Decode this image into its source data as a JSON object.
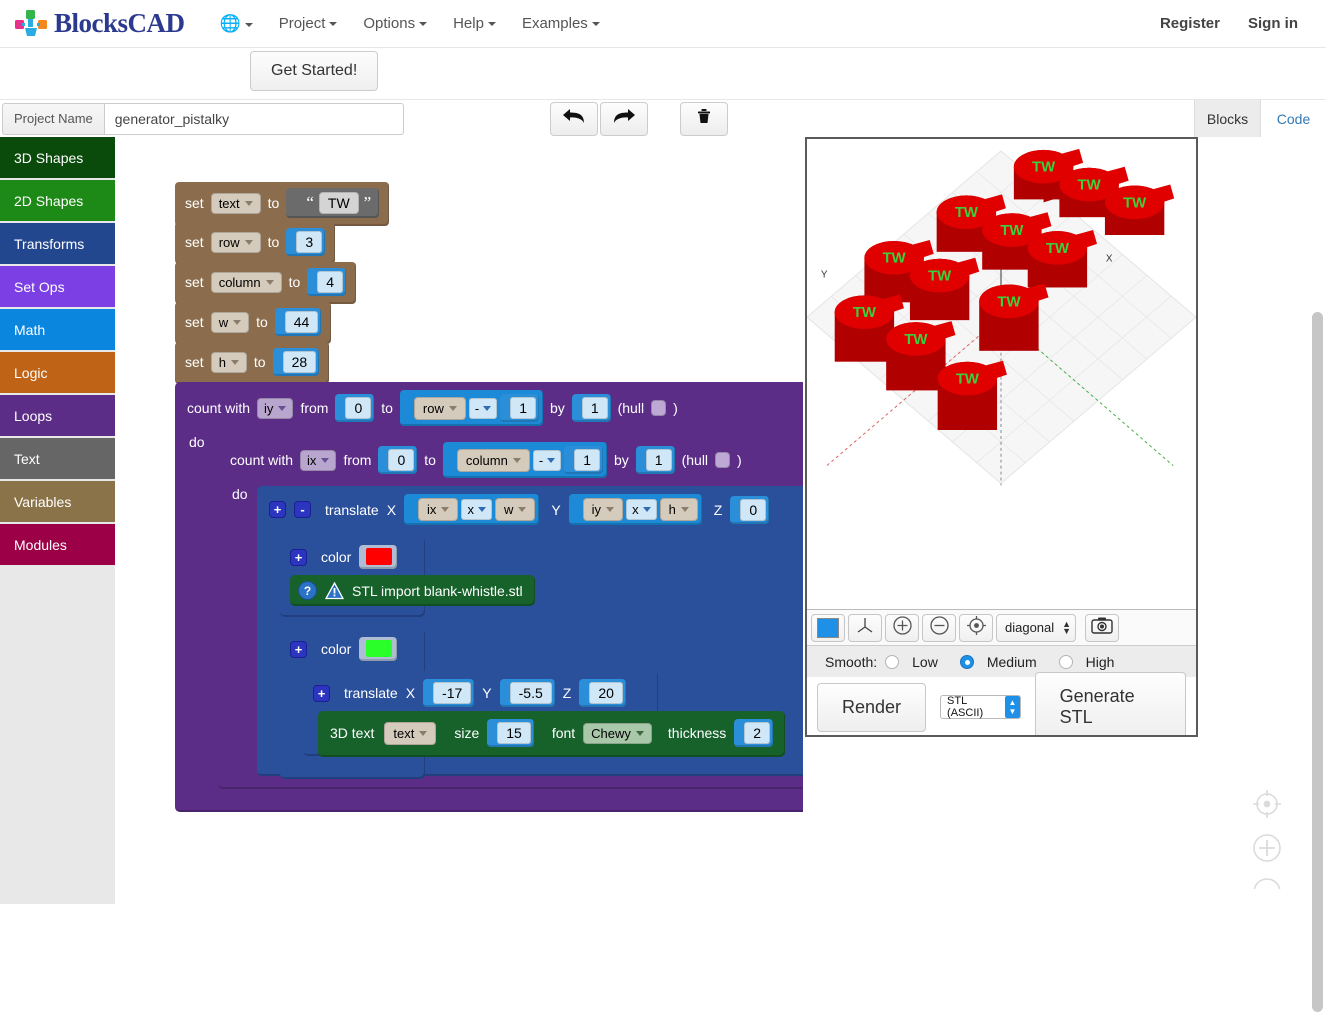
{
  "app": {
    "brand": "BlocksCAD",
    "logo_icon": "blockscad-logo-icon"
  },
  "navbar": {
    "language_icon": "globe-icon",
    "items": [
      {
        "label": "Project",
        "caret": true
      },
      {
        "label": "Options",
        "caret": true
      },
      {
        "label": "Help",
        "caret": true
      },
      {
        "label": "Examples",
        "caret": true
      }
    ],
    "right": [
      {
        "label": "Register"
      },
      {
        "label": "Sign in"
      }
    ]
  },
  "subbar": {
    "get_started_label": "Get Started!"
  },
  "projectbar": {
    "label": "Project Name",
    "value": "generator_pistalky",
    "placeholder": "Project Name",
    "undo_icon": "undo-arrow-icon",
    "redo_icon": "redo-arrow-icon",
    "trash_icon": "trash-icon",
    "tabs": [
      {
        "label": "Blocks",
        "active": true
      },
      {
        "label": "Code",
        "active": false
      }
    ]
  },
  "sidebar": {
    "items": [
      {
        "label": "3D Shapes",
        "color": "#0a4a0a"
      },
      {
        "label": "2D Shapes",
        "color": "#1d8a17"
      },
      {
        "label": "Transforms",
        "color": "#23478f"
      },
      {
        "label": "Set Ops",
        "color": "#7b3fe4"
      },
      {
        "label": "Math",
        "color": "#0b86de"
      },
      {
        "label": "Logic",
        "color": "#bf6317"
      },
      {
        "label": "Loops",
        "color": "#5b2d87"
      },
      {
        "label": "Text",
        "color": "#666666"
      },
      {
        "label": "Variables",
        "color": "#8b7349"
      },
      {
        "label": "Modules",
        "color": "#9c0046"
      }
    ]
  },
  "workspace": {
    "set_blocks": [
      {
        "set": "set",
        "variable": "text",
        "to": "to",
        "value": "TW",
        "kind": "string"
      },
      {
        "set": "set",
        "variable": "row",
        "to": "to",
        "value": "3",
        "kind": "number"
      },
      {
        "set": "set",
        "variable": "column",
        "to": "to",
        "value": "4",
        "kind": "number"
      },
      {
        "set": "set",
        "variable": "w",
        "to": "to",
        "value": "44",
        "kind": "number"
      },
      {
        "set": "set",
        "variable": "h",
        "to": "to",
        "value": "28",
        "kind": "number"
      }
    ],
    "outer_loop": {
      "count_with": "count with",
      "var": "iy",
      "from_label": "from",
      "from": "0",
      "to_label": "to",
      "operand": "row",
      "operator": "-",
      "operand2": "1",
      "by_label": "by",
      "by": "1",
      "hull_label": "(hull",
      "hull_close": ")",
      "hull_checked": false,
      "do_label": "do"
    },
    "inner_loop": {
      "count_with": "count with",
      "var": "ix",
      "from_label": "from",
      "from": "0",
      "to_label": "to",
      "operand": "column",
      "operator": "-",
      "operand2": "1",
      "by_label": "by",
      "by": "1",
      "hull_label": "(hull",
      "hull_close": ")",
      "hull_checked": false,
      "do_label": "do"
    },
    "translate_grid": {
      "label": "translate",
      "mutator_add": "+",
      "mutator_remove": "-",
      "x_label": "X",
      "x_a": "ix",
      "x_op": "x",
      "x_b": "w",
      "y_label": "Y",
      "y_a": "iy",
      "y_op": "x",
      "y_b": "h",
      "z_label": "Z",
      "z": "0"
    },
    "color_red": {
      "label": "color",
      "mutator_add": "+",
      "swatch": "#ff0000"
    },
    "stl_import": {
      "help_icon": "question-mark-icon",
      "warn_icon": "warning-triangle-icon",
      "label": "STL import blank-whistle.stl"
    },
    "color_green": {
      "label": "color",
      "mutator_add": "+",
      "swatch": "#2aff2a"
    },
    "translate_text": {
      "label": "translate",
      "mutator_add": "+",
      "x_label": "X",
      "x": "-17",
      "y_label": "Y",
      "y": "-5.5",
      "z_label": "Z",
      "z": "20"
    },
    "text3d": {
      "label": "3D text",
      "text_var": "text",
      "size_label": "size",
      "size": "15",
      "font_label": "font",
      "font": "Chewy",
      "thickness_label": "thickness",
      "thickness": "2"
    },
    "zoom_controls": [
      {
        "icon": "center-target-icon"
      },
      {
        "icon": "zoom-in-icon"
      },
      {
        "icon": "zoom-out-icon"
      }
    ]
  },
  "viewport": {
    "scene_description": "3x4 grid of red whistle shapes with green TW text",
    "object_count": 12,
    "object_label": "TW",
    "object_color": "#e00000",
    "text_color": "#3ad13a",
    "toolbar": {
      "color_swatch": "#1e90e8",
      "color_icon": "color-swatch-icon",
      "axes_icon": "axes-icon",
      "zoom_in_icon": "zoom-in-icon",
      "zoom_out_icon": "zoom-out-icon",
      "center_icon": "recenter-icon",
      "view_select": "diagonal",
      "camera_icon": "camera-icon"
    },
    "smooth": {
      "label": "Smooth:",
      "options": [
        {
          "label": "Low",
          "selected": false
        },
        {
          "label": "Medium",
          "selected": true
        },
        {
          "label": "High",
          "selected": false
        }
      ]
    },
    "render_label": "Render",
    "format": "STL (ASCII)",
    "generate_label": "Generate STL"
  }
}
